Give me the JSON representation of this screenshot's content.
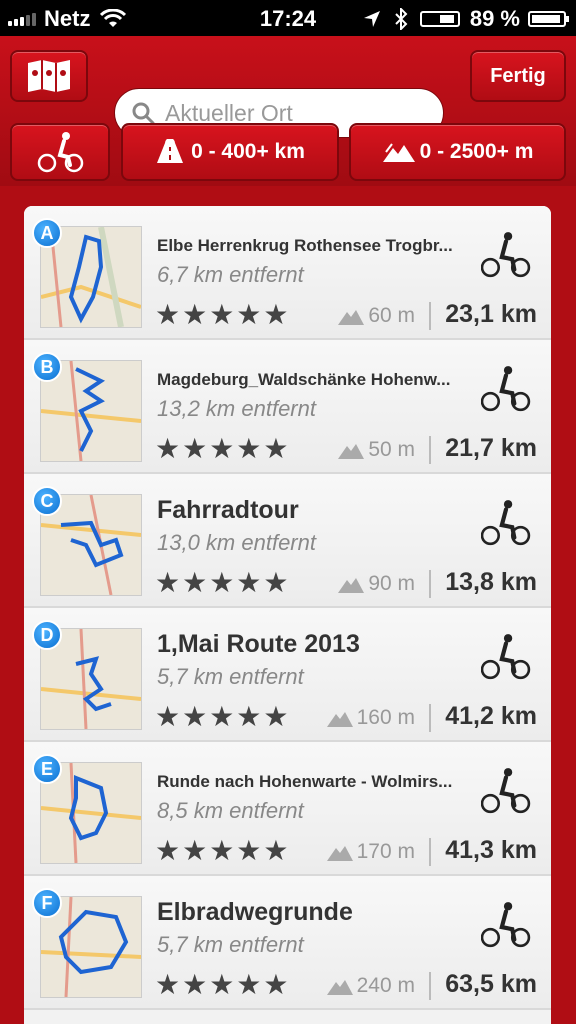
{
  "status": {
    "carrier": "Netz",
    "time": "17:24",
    "battery": "89 %"
  },
  "header": {
    "search_placeholder": "Aktueller Ort",
    "done_label": "Fertig",
    "distance_filter": "0 - 400+ km",
    "elevation_filter": "0 - 2500+ m"
  },
  "routes": [
    {
      "letter": "A",
      "title": "Elbe Herrenkrug Rothensee Trogbr...",
      "distance": "6,7 km entfernt",
      "stars": "★★★★★",
      "elevation": "60 m",
      "length": "23,1 km"
    },
    {
      "letter": "B",
      "title": "Magdeburg_Waldschänke Hohenw...",
      "distance": "13,2 km entfernt",
      "stars": "★★★★★",
      "elevation": "50 m",
      "length": "21,7 km"
    },
    {
      "letter": "C",
      "title": "Fahrradtour",
      "distance": "13,0 km entfernt",
      "stars": "★★★★★",
      "elevation": "90 m",
      "length": "13,8 km"
    },
    {
      "letter": "D",
      "title": "1,Mai Route 2013",
      "distance": "5,7 km entfernt",
      "stars": "★★★★★",
      "elevation": "160 m",
      "length": "41,2 km"
    },
    {
      "letter": "E",
      "title": "Runde nach Hohenwarte - Wolmirs...",
      "distance": "8,5 km entfernt",
      "stars": "★★★★★",
      "elevation": "170 m",
      "length": "41,3 km"
    },
    {
      "letter": "F",
      "title": "Elbradwegrunde",
      "distance": "5,7 km entfernt",
      "stars": "★★★★★",
      "elevation": "240 m",
      "length": "63,5 km"
    }
  ],
  "colors": {
    "header_red": "#c8101a",
    "badge_blue": "#1a82e0",
    "route_blue": "#1e64d2"
  }
}
